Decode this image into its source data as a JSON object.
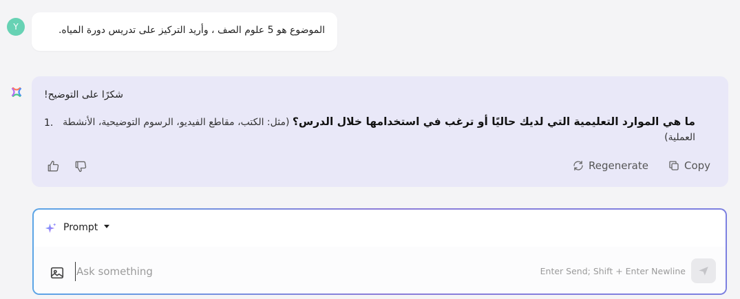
{
  "user_message": {
    "avatar_letter": "Y",
    "text": "الموضوع هو 5 علوم الصف ، وأريد التركيز على تدريس دورة المياه."
  },
  "assistant_message": {
    "greeting": "شكرًا على التوضيح!",
    "item_number": "1.",
    "item_bold": "ما هي الموارد التعليمية التي لديك حاليًا أو ترغب في استخدامها خلال الدرس؟",
    "item_rest": " (مثل: الكتب، مقاطع الفيديو، الرسوم التوضيحية، الأنشطة العملية)",
    "actions": {
      "regenerate_label": "Regenerate",
      "copy_label": "Copy"
    }
  },
  "prompt_box": {
    "mode_label": "Prompt",
    "input_placeholder": "Ask something",
    "input_value": "",
    "send_hint": "Enter Send; Shift + Enter Newline"
  },
  "colors": {
    "background": "#f4f4f6",
    "user_avatar": "#67d2b4",
    "assistant_bubble": "#e9e8f8",
    "accent_gradient_start": "#5ba4e6",
    "accent_gradient_end": "#8b7bd8"
  },
  "icons": {
    "thumbs_up": "thumbs-up-icon",
    "thumbs_down": "thumbs-down-icon",
    "regenerate": "refresh-icon",
    "copy": "copy-icon",
    "sparkle": "sparkle-icon",
    "image": "image-icon",
    "send": "send-icon",
    "logo": "app-logo-icon"
  }
}
